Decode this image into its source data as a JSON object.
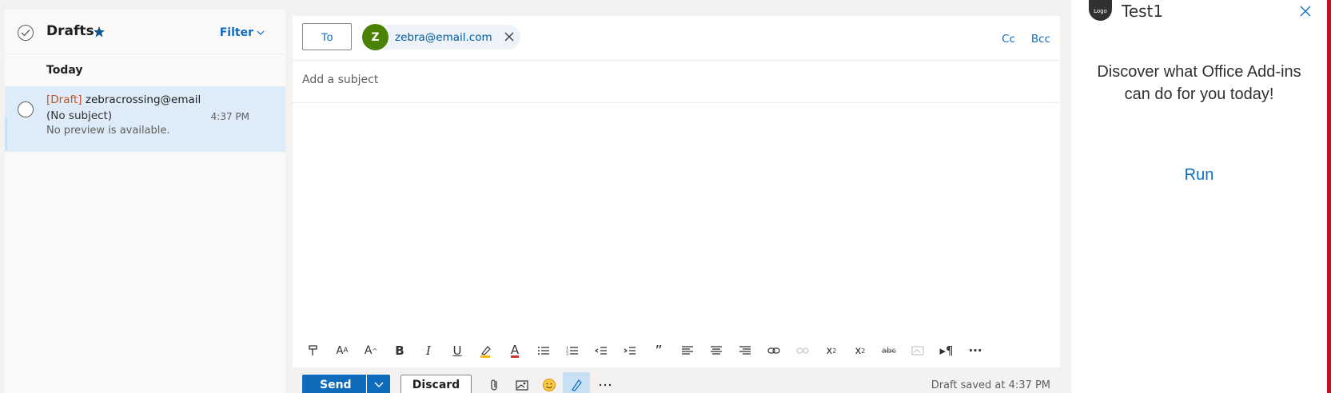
{
  "folder": {
    "title": "Drafts",
    "filter_label": "Filter",
    "group_label": "Today",
    "items": [
      {
        "tag": "[Draft]",
        "recipient": "zebracrossing@email",
        "subject": "(No subject)",
        "preview": "No preview is available.",
        "time": "4:37 PM"
      }
    ]
  },
  "compose": {
    "to_label": "To",
    "recipient": {
      "initial": "Z",
      "email": "zebra@email.com",
      "avatar_color": "#498205"
    },
    "cc_label": "Cc",
    "bcc_label": "Bcc",
    "subject_placeholder": "Add a subject",
    "send_label": "Send",
    "discard_label": "Discard",
    "draft_status": "Draft saved at 4:37 PM",
    "format_icons": [
      "format-painter-icon",
      "font-size-icon",
      "font-grow-icon",
      "bold-icon",
      "italic-icon",
      "underline-icon",
      "highlight-icon",
      "font-color-icon",
      "bullets-icon",
      "numbering-icon",
      "decrease-indent-icon",
      "increase-indent-icon",
      "quote-icon",
      "align-left-icon",
      "align-center-icon",
      "align-right-icon",
      "link-icon",
      "unlink-icon",
      "superscript-icon",
      "subscript-icon",
      "strikethrough-icon",
      "image-alt-icon",
      "ltr-icon",
      "more-icon"
    ]
  },
  "addin": {
    "logo_text": "Logo",
    "title": "Test1",
    "message": "Discover what Office Add-ins can do for you today!",
    "run_label": "Run"
  },
  "colors": {
    "accent": "#0f6cbd",
    "selected_item": "#deecf9",
    "draft_tag": "#c4501b",
    "edge": "#c50f1f"
  }
}
